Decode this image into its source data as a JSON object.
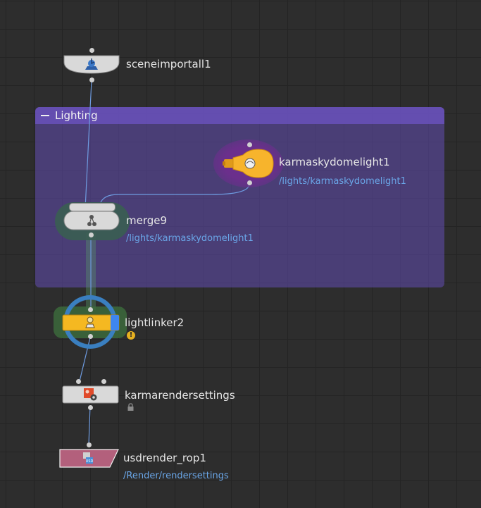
{
  "network_box": {
    "title": "Lighting"
  },
  "nodes": {
    "sceneimportall": {
      "name": "sceneimportall1"
    },
    "skydome": {
      "name": "karmaskydomelight1",
      "path": "/lights/karmaskydomelight1"
    },
    "merge": {
      "name": "merge9",
      "path": "/lights/karmaskydomelight1"
    },
    "lightlinker": {
      "name": "lightlinker2",
      "warning_glyph": "!"
    },
    "rendersettings": {
      "name": "karmarendersettings"
    },
    "usdrender": {
      "name": "usdrender_rop1",
      "path": "/Render/rendersettings"
    }
  },
  "icons": {
    "sceneimportall": "scene-import-icon",
    "skydome": "light-bulb-icon",
    "merge": "merge-icon",
    "lightlinker": "light-linker-icon",
    "rendersettings": "render-settings-icon",
    "usdrender": "usd-render-icon",
    "lock": "lock-icon",
    "warning": "warning-icon"
  },
  "colors": {
    "background": "#2d2d2d",
    "network_box": "#624cb2",
    "wire": "#6e9be0",
    "node_gray": "#d9d9d9",
    "lightlinker_yellow": "#f5b821",
    "lightlinker_flag": "#3f86f0",
    "skydome_yellow": "#f7b42c",
    "usdrender_pink": "#b3607c",
    "subtext_blue": "#6aa6e8"
  }
}
